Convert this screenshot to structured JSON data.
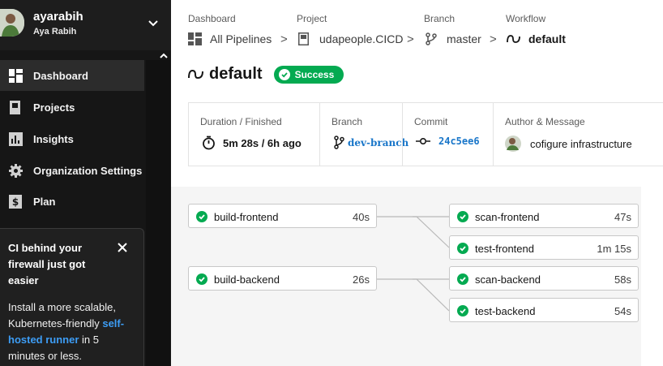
{
  "user": {
    "username": "ayarabih",
    "full_name": "Aya Rabih"
  },
  "nav": {
    "items": [
      {
        "label": "Dashboard",
        "icon": "dashboard-icon",
        "active": true
      },
      {
        "label": "Projects",
        "icon": "projects-icon"
      },
      {
        "label": "Insights",
        "icon": "insights-icon"
      },
      {
        "label": "Organization Settings",
        "icon": "gear-icon"
      },
      {
        "label": "Plan",
        "icon": "plan-icon"
      }
    ]
  },
  "promo": {
    "title": "CI behind your firewall just got easier",
    "body_before": "Install a more scalable, Kubernetes-friendly ",
    "link": "self-hosted runner",
    "body_after": " in 5 minutes or less."
  },
  "breadcrumb": {
    "dashboard": {
      "title": "Dashboard",
      "value": "All Pipelines"
    },
    "project": {
      "title": "Project",
      "value": "udapeople.CICD"
    },
    "branch": {
      "title": "Branch",
      "value": "master"
    },
    "workflow": {
      "title": "Workflow",
      "value": "default"
    }
  },
  "workflow": {
    "name": "default",
    "status": "Success"
  },
  "meta": {
    "duration_label": "Duration / Finished",
    "duration_value": "5m 28s / 6h ago",
    "branch_label": "Branch",
    "branch_value": "dev-branch",
    "commit_label": "Commit",
    "commit_value": "24c5ee6",
    "author_label": "Author & Message",
    "author_value": "cofigure infrastructure"
  },
  "jobs": {
    "build_frontend": {
      "name": "build-frontend",
      "duration": "40s"
    },
    "build_backend": {
      "name": "build-backend",
      "duration": "26s"
    },
    "scan_frontend": {
      "name": "scan-frontend",
      "duration": "47s"
    },
    "test_frontend": {
      "name": "test-frontend",
      "duration": "1m 15s"
    },
    "scan_backend": {
      "name": "scan-backend",
      "duration": "58s"
    },
    "test_backend": {
      "name": "test-backend",
      "duration": "54s"
    }
  },
  "colors": {
    "success": "#04AA51",
    "sidebar": "#161616",
    "link": "#3d9df5",
    "commit": "#1976c9"
  }
}
